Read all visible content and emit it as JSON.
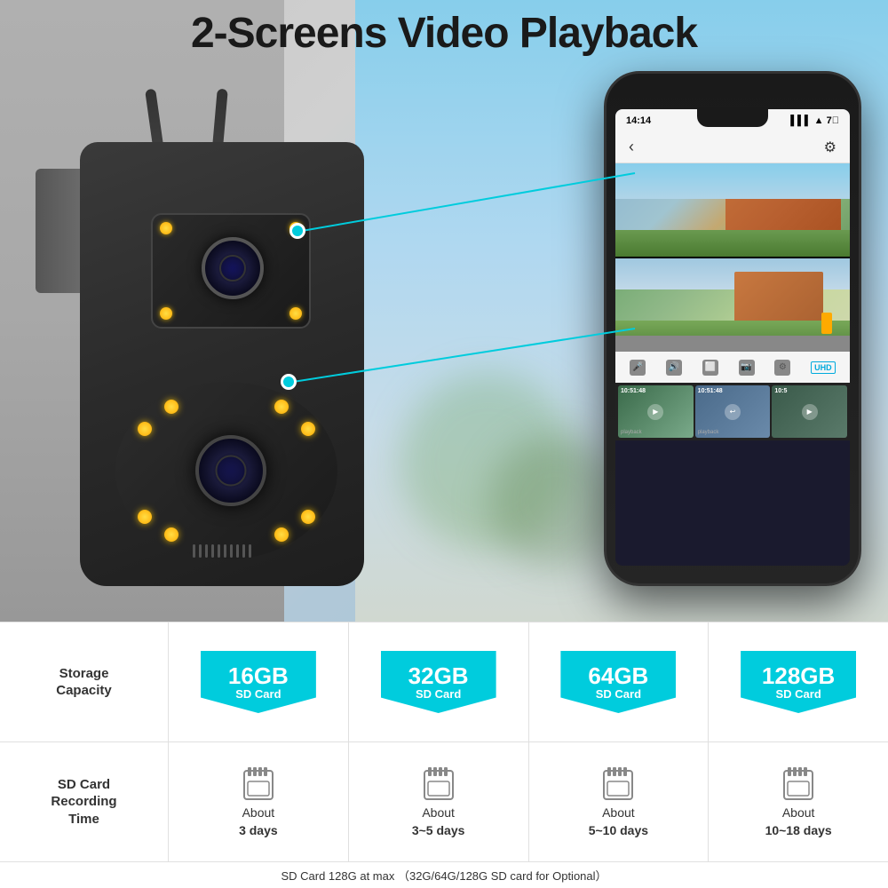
{
  "title": "2-Screens Video Playback",
  "phone": {
    "time": "14:14",
    "nav_back": "‹",
    "nav_settings": "⚙"
  },
  "storage": {
    "label": "Storage\nCapacity",
    "items": [
      {
        "size": "16GB",
        "type": "SD Card"
      },
      {
        "size": "32GB",
        "type": "SD Card"
      },
      {
        "size": "64GB",
        "type": "SD Card"
      },
      {
        "size": "128GB",
        "type": "SD Card"
      }
    ]
  },
  "recording": {
    "label": "SD Card\nRecording\nTime",
    "items": [
      {
        "about": "About",
        "time": "3 days"
      },
      {
        "about": "About",
        "time": "3~5 days"
      },
      {
        "about": "About",
        "time": "5~10 days"
      },
      {
        "about": "About",
        "time": "10~18 days"
      }
    ]
  },
  "footer_note": "SD Card 128G at max  （32G/64G/128G SD card for Optional）",
  "thumbnails": [
    {
      "time": "10:51:48",
      "label": "playback"
    },
    {
      "time": "10:51:48",
      "label": "playback"
    },
    {
      "time": "10:5",
      "label": ""
    }
  ],
  "controls": [
    "🎤",
    "🔊",
    "📹",
    "📷",
    "⚙",
    "UHD"
  ]
}
